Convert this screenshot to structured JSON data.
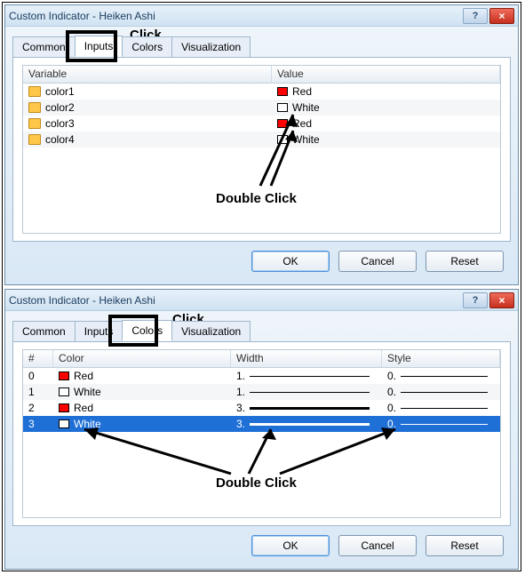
{
  "dialog1": {
    "title": "Custom Indicator - Heiken Ashi",
    "help": "?",
    "close": "×",
    "click_label": "Click",
    "tabs": {
      "common": "Common",
      "inputs": "Inputs",
      "colors": "Colors",
      "visualization": "Visualization"
    },
    "headers": {
      "variable": "Variable",
      "value": "Value"
    },
    "rows": {
      "r1": {
        "name": "color1",
        "value": "Red",
        "color": "red"
      },
      "r2": {
        "name": "color2",
        "value": "White",
        "color": "white"
      },
      "r3": {
        "name": "color3",
        "value": "Red",
        "color": "red"
      },
      "r4": {
        "name": "color4",
        "value": "White",
        "color": "white"
      }
    },
    "dblclick": "Double Click",
    "buttons": {
      "ok": "OK",
      "cancel": "Cancel",
      "reset": "Reset"
    }
  },
  "dialog2": {
    "title": "Custom Indicator - Heiken Ashi",
    "help": "?",
    "close": "×",
    "click_label": "Click",
    "tabs": {
      "common": "Common",
      "inputs": "Inputs",
      "colors": "Colors",
      "visualization": "Visualization"
    },
    "headers": {
      "num": "#",
      "color": "Color",
      "width": "Width",
      "style": "Style"
    },
    "rows": {
      "r0": {
        "num": "0",
        "color": "Red",
        "colorv": "red",
        "width": "1.",
        "style": "0."
      },
      "r1": {
        "num": "1",
        "color": "White",
        "colorv": "white",
        "width": "1.",
        "style": "0."
      },
      "r2": {
        "num": "2",
        "color": "Red",
        "colorv": "red",
        "width": "3.",
        "style": "0."
      },
      "r3": {
        "num": "3",
        "color": "White",
        "colorv": "white",
        "width": "3.",
        "style": "0."
      }
    },
    "dblclick": "Double Click",
    "buttons": {
      "ok": "OK",
      "cancel": "Cancel",
      "reset": "Reset"
    }
  }
}
